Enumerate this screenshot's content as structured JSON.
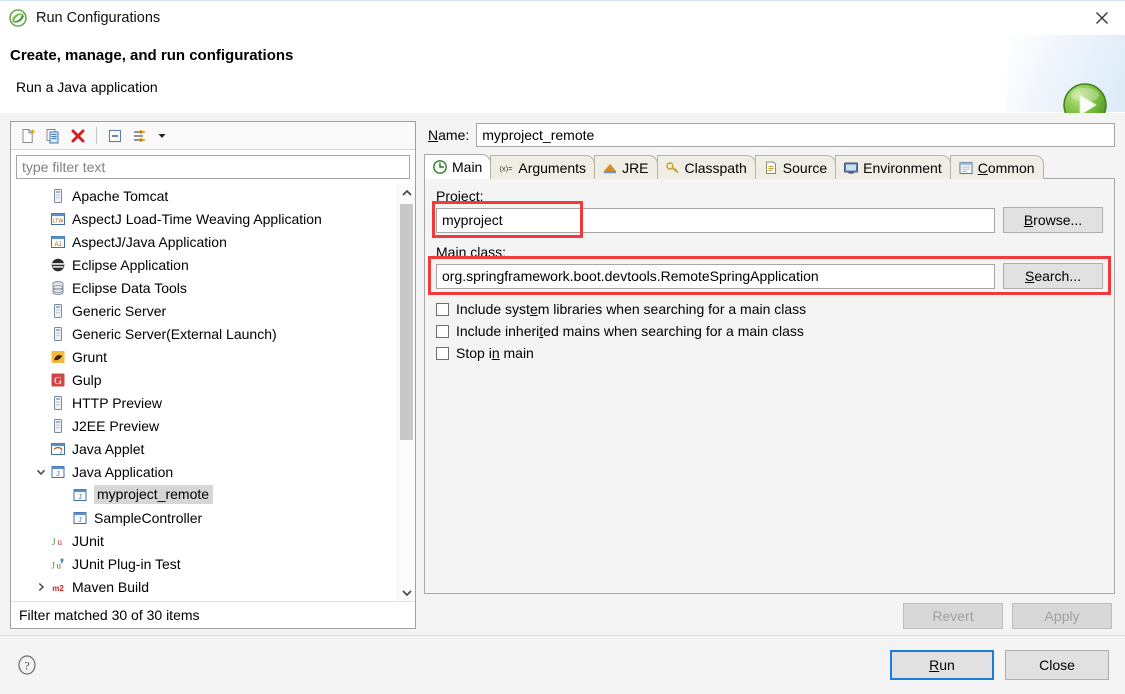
{
  "window": {
    "title": "Run Configurations",
    "icon": "eclipse-logo-icon",
    "close_icon": "close-icon"
  },
  "header": {
    "title": "Create, manage, and run configurations",
    "subtitle": "Run a Java application",
    "play_icon": "green-play-icon"
  },
  "left_panel": {
    "toolbar": [
      {
        "name": "new-configuration-icon",
        "tooltip": "New launch configuration"
      },
      {
        "name": "duplicate-icon",
        "tooltip": "Duplicate"
      },
      {
        "name": "delete-icon",
        "tooltip": "Delete"
      },
      {
        "name": "collapse-all-icon",
        "tooltip": "Collapse All"
      },
      {
        "name": "filter-icon",
        "tooltip": "Filter launch configurations"
      },
      {
        "name": "chevron-down-icon",
        "tooltip": "View Menu"
      }
    ],
    "filter": {
      "value": "",
      "placeholder": "type filter text"
    },
    "status": "Filter matched 30 of 30 items",
    "tree": [
      {
        "label": "Apache Tomcat",
        "icon": "server-icon",
        "indent": 1,
        "twisty": "",
        "selected": false
      },
      {
        "label": "AspectJ Load-Time Weaving Application",
        "icon": "ltw-icon",
        "indent": 1,
        "twisty": "",
        "selected": false
      },
      {
        "label": "AspectJ/Java Application",
        "icon": "aj-icon",
        "indent": 1,
        "twisty": "",
        "selected": false
      },
      {
        "label": "Eclipse Application",
        "icon": "eclipse-app-icon",
        "indent": 1,
        "twisty": "",
        "selected": false
      },
      {
        "label": "Eclipse Data Tools",
        "icon": "database-icon",
        "indent": 1,
        "twisty": "",
        "selected": false
      },
      {
        "label": "Generic Server",
        "icon": "server-icon",
        "indent": 1,
        "twisty": "",
        "selected": false
      },
      {
        "label": "Generic Server(External Launch)",
        "icon": "server-icon",
        "indent": 1,
        "twisty": "",
        "selected": false
      },
      {
        "label": "Grunt",
        "icon": "grunt-icon",
        "indent": 1,
        "twisty": "",
        "selected": false
      },
      {
        "label": "Gulp",
        "icon": "gulp-icon",
        "indent": 1,
        "twisty": "",
        "selected": false
      },
      {
        "label": "HTTP Preview",
        "icon": "server-icon",
        "indent": 1,
        "twisty": "",
        "selected": false
      },
      {
        "label": "J2EE Preview",
        "icon": "server-icon",
        "indent": 1,
        "twisty": "",
        "selected": false
      },
      {
        "label": "Java Applet",
        "icon": "java-applet-icon",
        "indent": 1,
        "twisty": "",
        "selected": false
      },
      {
        "label": "Java Application",
        "icon": "java-app-icon",
        "indent": 1,
        "twisty": "expanded",
        "selected": false
      },
      {
        "label": "myproject_remote",
        "icon": "java-app-icon",
        "indent": 2,
        "twisty": "",
        "selected": true
      },
      {
        "label": "SampleController",
        "icon": "java-app-icon",
        "indent": 2,
        "twisty": "",
        "selected": false
      },
      {
        "label": "JUnit",
        "icon": "junit-icon",
        "indent": 1,
        "twisty": "",
        "selected": false
      },
      {
        "label": "JUnit Plug-in Test",
        "icon": "junit-plugin-icon",
        "indent": 1,
        "twisty": "",
        "selected": false
      },
      {
        "label": "Maven Build",
        "icon": "maven-icon",
        "indent": 1,
        "twisty": "collapsed",
        "selected": false
      }
    ]
  },
  "right_panel": {
    "name_label": "Name:",
    "name_label_mnemonic": "N",
    "name_value": "myproject_remote",
    "tabs": [
      {
        "label": "Main",
        "icon": "main-tab-icon",
        "active": true
      },
      {
        "label": "Arguments",
        "icon": "arguments-tab-icon",
        "active": false
      },
      {
        "label": "JRE",
        "icon": "jre-tab-icon",
        "active": false
      },
      {
        "label": "Classpath",
        "icon": "classpath-tab-icon",
        "active": false
      },
      {
        "label": "Source",
        "icon": "source-tab-icon",
        "active": false
      },
      {
        "label": "Environment",
        "icon": "environment-tab-icon",
        "active": false
      },
      {
        "label": "Common",
        "icon": "common-tab-icon",
        "active": false,
        "mnemonic": "C"
      }
    ],
    "main_tab": {
      "project_label": "Project:",
      "project_value": "myproject",
      "browse_button": "Browse...",
      "main_class_label": "Main class:",
      "main_class_value": "org.springframework.boot.devtools.RemoteSpringApplication",
      "search_button": "Search...",
      "checkboxes": [
        {
          "label": "Include system libraries when searching for a main class",
          "checked": false
        },
        {
          "label": "Include inherited mains when searching for a main class",
          "checked": false
        },
        {
          "label": "Stop in main",
          "checked": false
        }
      ]
    },
    "revert_button": "Revert",
    "apply_button": "Apply",
    "revert_enabled": false,
    "apply_enabled": false
  },
  "footer": {
    "help_icon": "help-icon",
    "run_button": "Run",
    "close_button": "Close"
  },
  "colors": {
    "annotation_red": "#ef3b3b",
    "default_button_border": "#1a7fd4",
    "selection_gray": "#d6d6d6"
  }
}
